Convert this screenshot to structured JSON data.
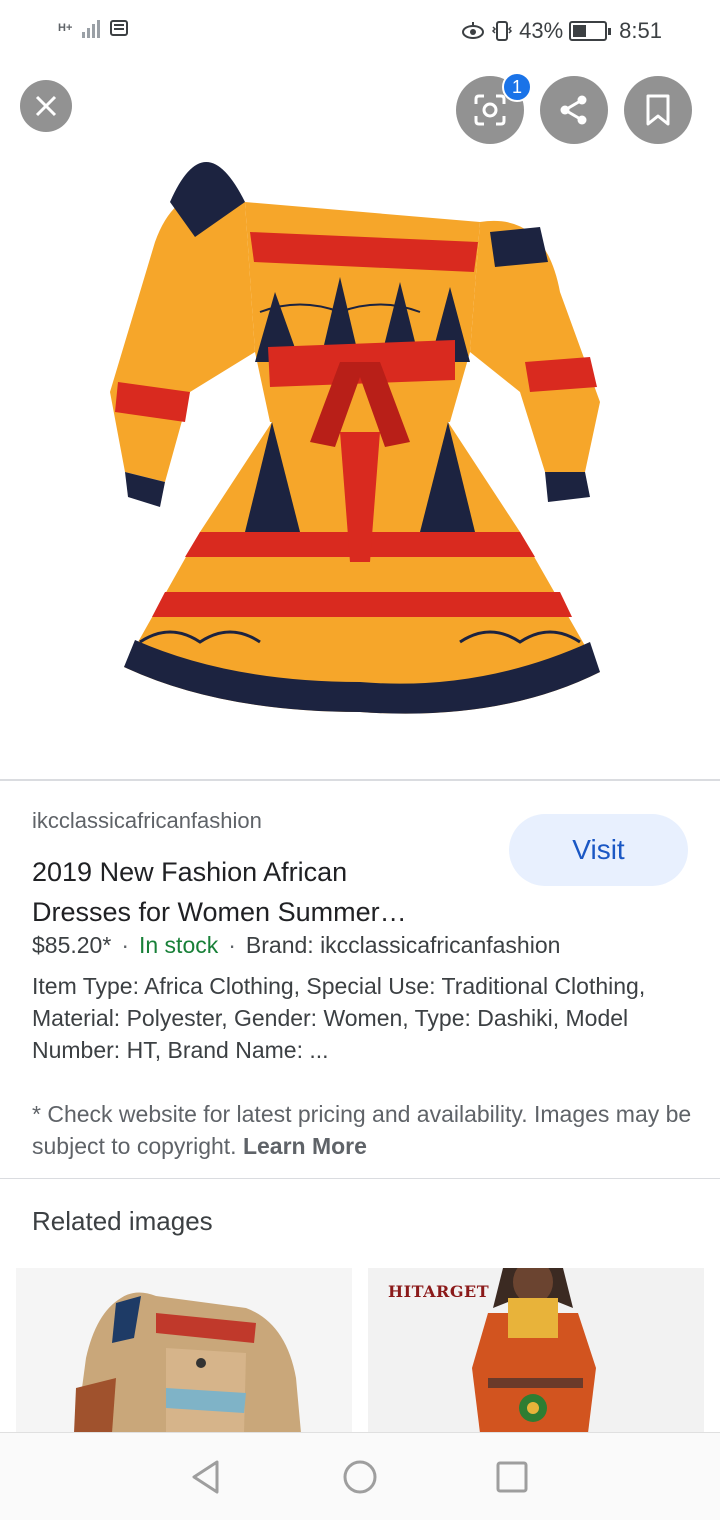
{
  "status_bar": {
    "network": "H+",
    "battery_percent": "43%",
    "battery_level": 0.43,
    "time": "8:51"
  },
  "hero": {
    "badge_count": "1",
    "icons": [
      "close-icon",
      "lens-icon",
      "share-icon",
      "bookmark-icon"
    ]
  },
  "product": {
    "source": "ikcclassicafricanfashion",
    "visit_label": "Visit",
    "title": "2019 New Fashion African Dresses for Women Summer…",
    "price": "$85.20*",
    "stock": "In stock",
    "brand": "Brand: ikcclassicafricanfashion",
    "description": "Item Type: Africa Clothing, Special Use: Traditional Clothing, Material: Polyester, Gender: Women, Type: Dashiki, Model Number: HT, Brand Name: ...",
    "disclaimer": "* Check website for latest pricing and availability. Images may be subject to copyright.",
    "learn_more": "Learn More"
  },
  "related": {
    "heading": "Related images",
    "items": [
      {
        "watermark": ""
      },
      {
        "watermark": "HITARGET"
      }
    ]
  },
  "colors": {
    "accent": "#1a73e8",
    "visit_bg": "#e8f0fe",
    "stock_green": "#188038",
    "dress_orange": "#f6a62a",
    "dress_red": "#d92a1f",
    "dress_navy": "#1c2340"
  }
}
